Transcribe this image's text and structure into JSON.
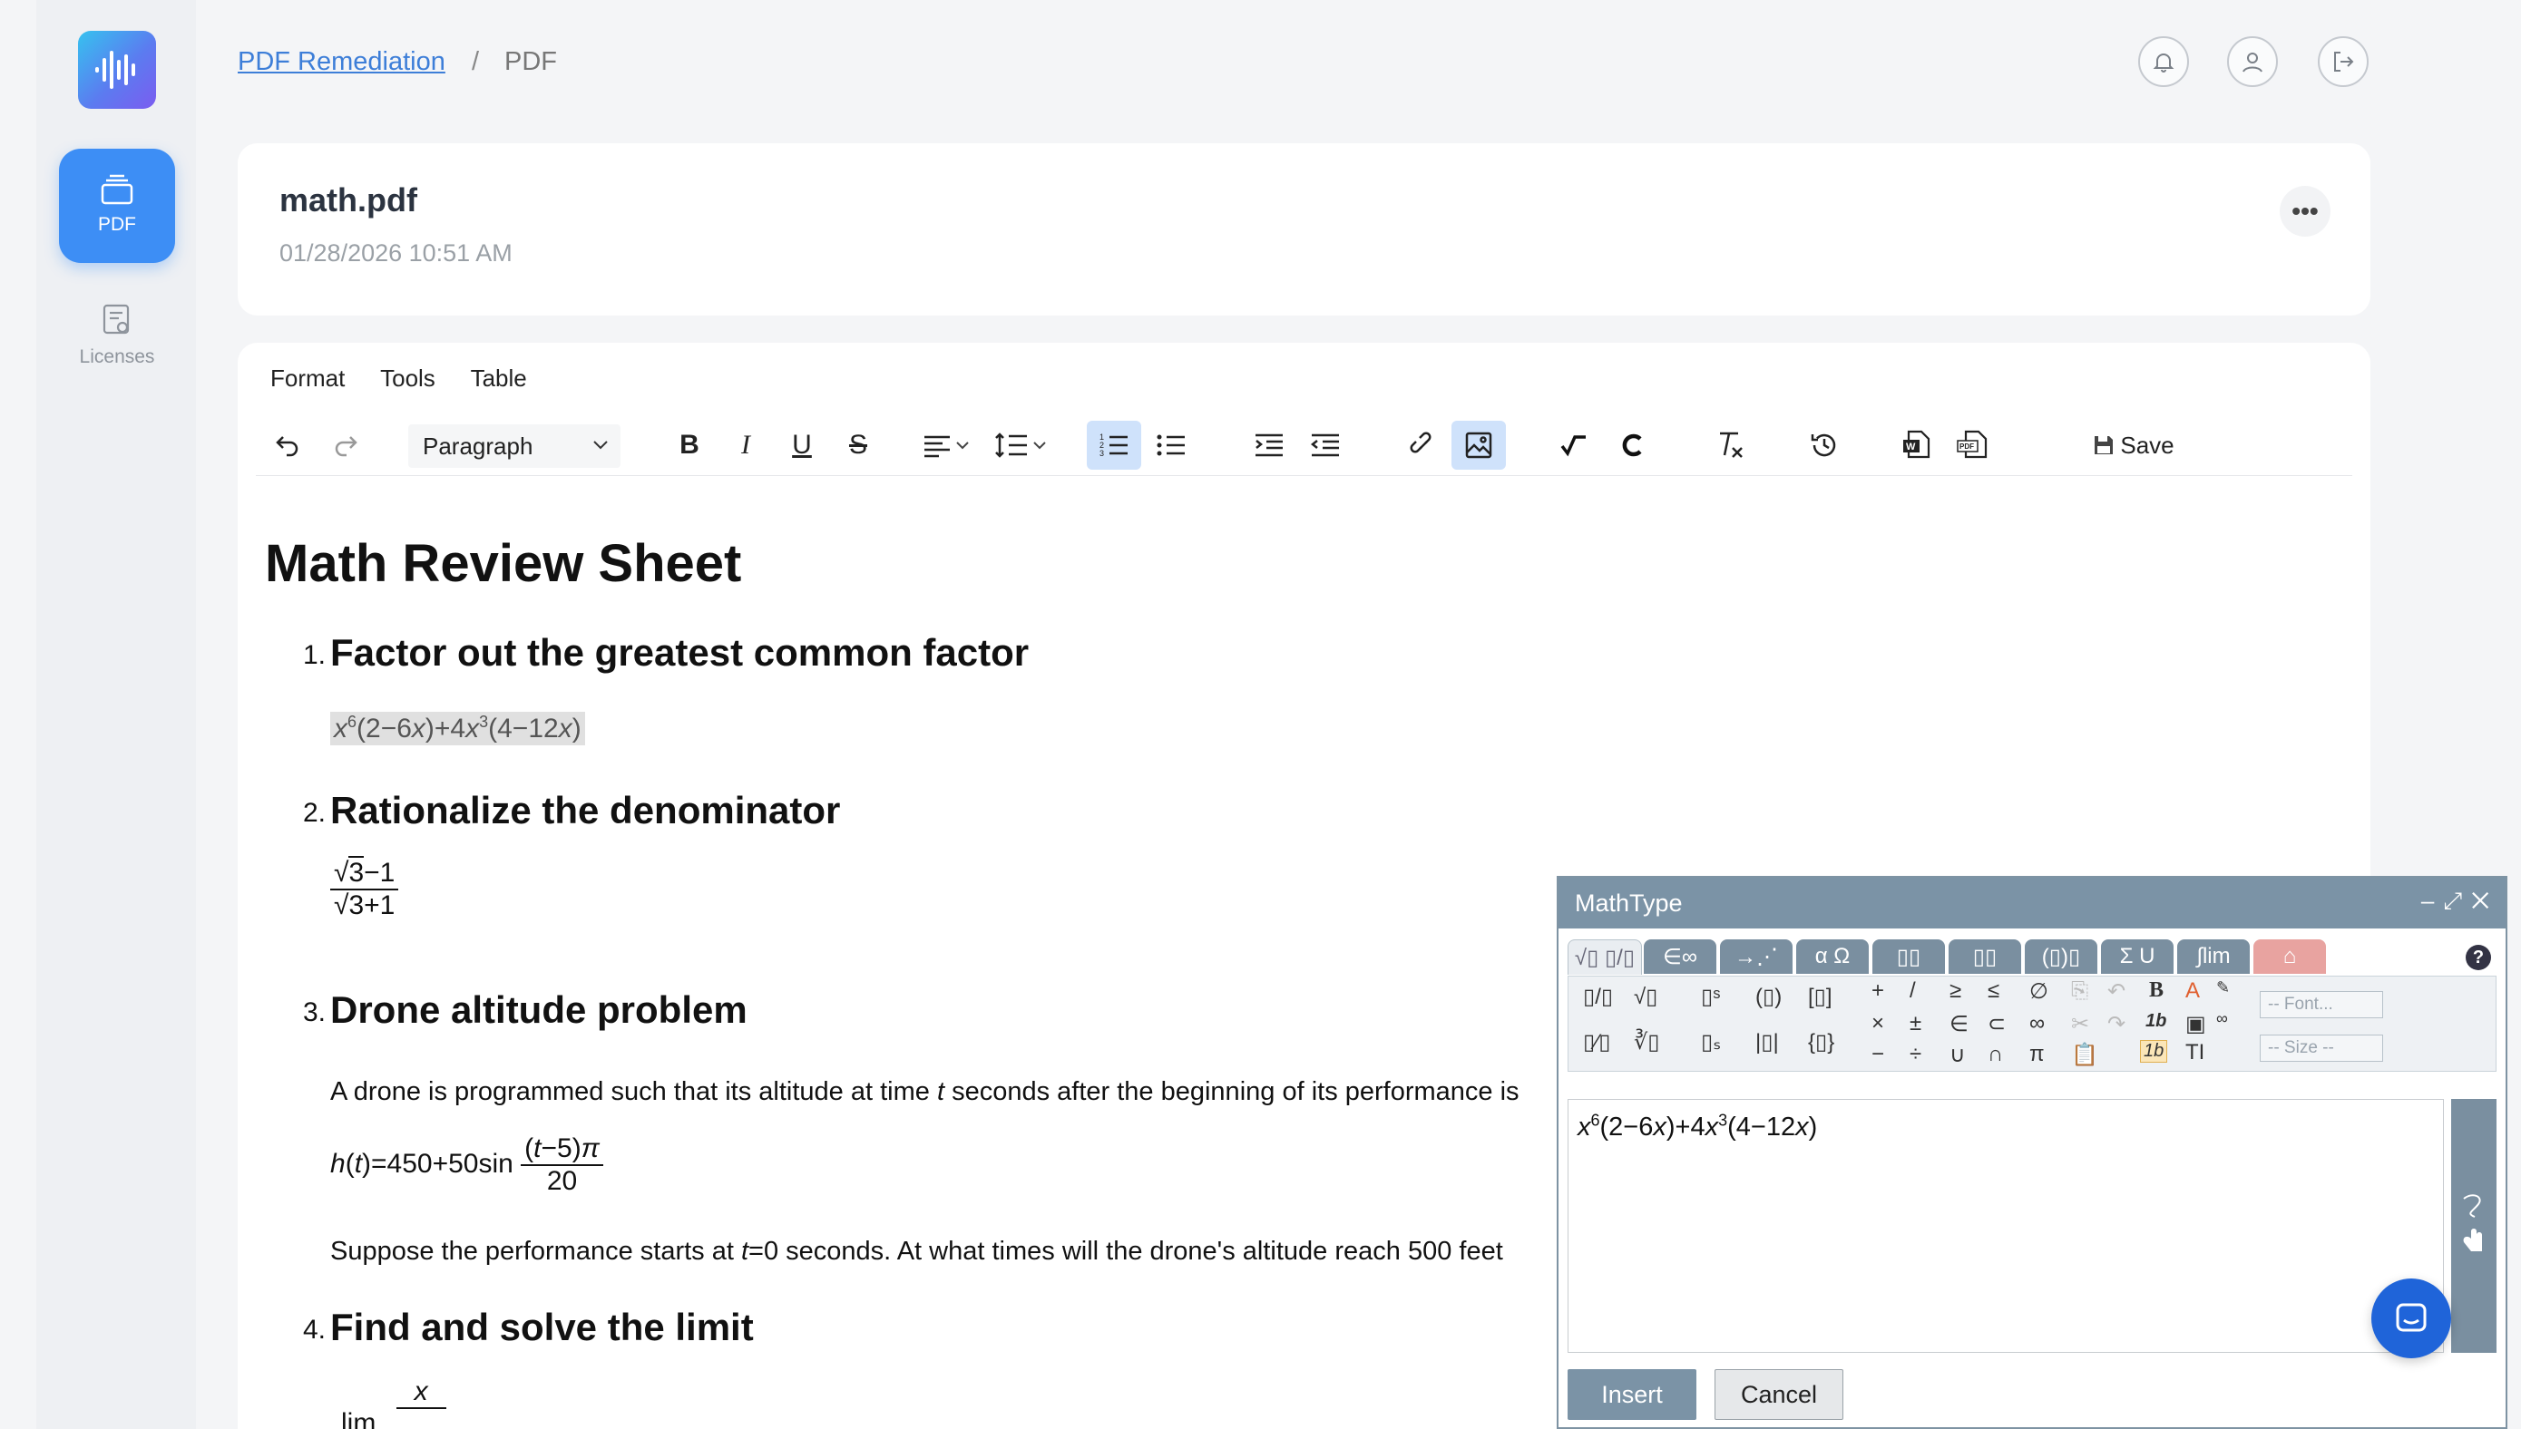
{
  "sidebar": {
    "items": [
      {
        "label": "PDF",
        "icon": "pdf-stack-icon"
      },
      {
        "label": "Licenses",
        "icon": "license-icon"
      }
    ]
  },
  "breadcrumb": {
    "link": "PDF Remediation",
    "separator": "/",
    "current": "PDF"
  },
  "header_icons": [
    "bell-icon",
    "user-icon",
    "logout-icon"
  ],
  "file": {
    "name": "math.pdf",
    "date": "01/28/2026 10:51 AM",
    "menu": "•••"
  },
  "editor": {
    "menus": [
      "Format",
      "Tools",
      "Table"
    ],
    "block_format": "Paragraph",
    "save_label": "Save",
    "toolbar_icons": [
      "undo-icon",
      "redo-icon",
      "bold-icon",
      "italic-icon",
      "underline-icon",
      "strikethrough-icon",
      "align-icon",
      "line-height-icon",
      "numbered-list-icon",
      "bullet-list-icon",
      "indent-icon",
      "outdent-icon",
      "link-icon",
      "image-icon",
      "mathtype-icon",
      "chemtype-icon",
      "clear-format-icon",
      "history-icon",
      "word-export-icon",
      "pdf-export-icon",
      "save-icon"
    ]
  },
  "doc": {
    "title": "Math Review Sheet",
    "sections": [
      {
        "num": "1.",
        "heading": "Factor out the greatest common factor"
      },
      {
        "num": "2.",
        "heading": "Rationalize the denominator"
      },
      {
        "num": "3.",
        "heading": "Drone altitude problem"
      },
      {
        "num": "4.",
        "heading": "Find and solve the limit"
      }
    ],
    "drone_text": "A drone is programmed such that its altitude at time",
    "drone_text_tail": "seconds after the beginning of its performance is",
    "drone_question": "Suppose the performance starts at",
    "drone_question_tail": "seconds. At what times will the drone's altitude reach 500 feet",
    "limit_word": "lim"
  },
  "mathtype": {
    "title": "MathType",
    "expression": "x6(2−6x)+4x3(4−12x)",
    "font_placeholder": "-- Font...",
    "size_placeholder": "-- Size --",
    "insert_label": "Insert",
    "cancel_label": "Cancel",
    "tabs": [
      "√▯ ▯/▯",
      "∈∞",
      "→⋰",
      "α Ω",
      "▯▯",
      "▯▯",
      "(▯)▯",
      "Σ U",
      "∫lim",
      "⌂"
    ]
  }
}
